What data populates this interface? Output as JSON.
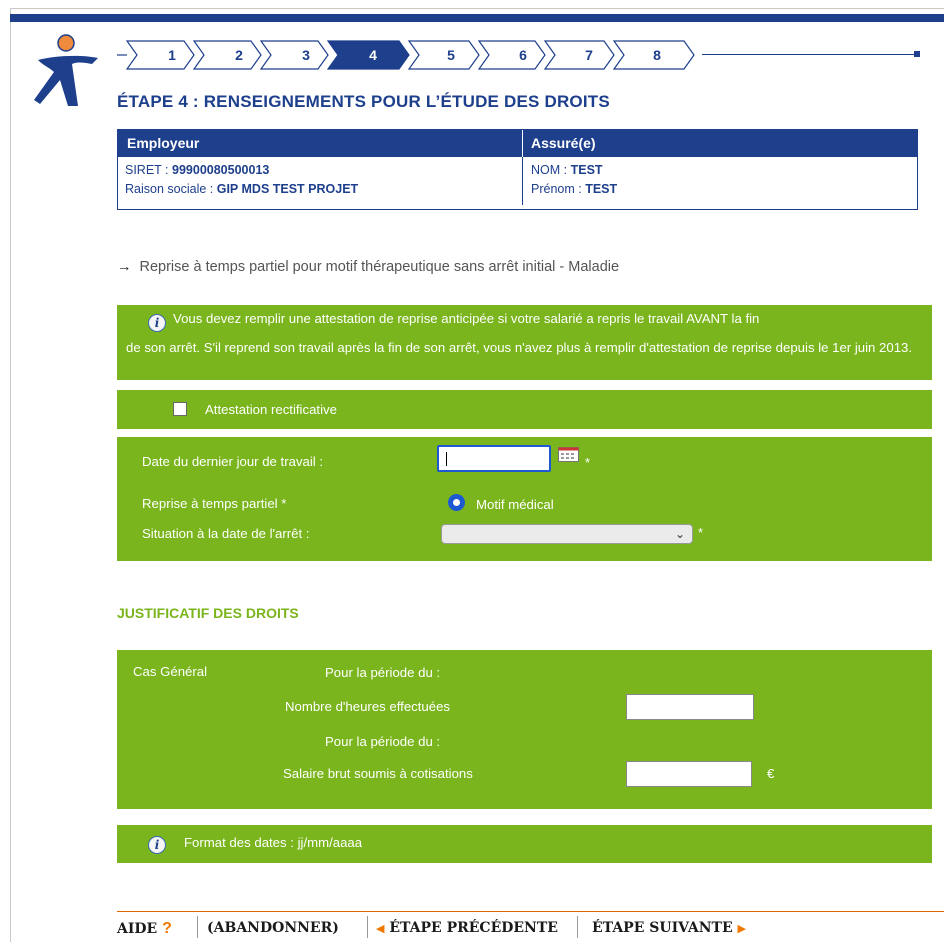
{
  "steps": [
    "1",
    "2",
    "3",
    "4",
    "5",
    "6",
    "7",
    "8"
  ],
  "active_step": "4",
  "page_title": "ÉTAPE 4 : RENSEIGNEMENTS POUR L’ÉTUDE DES DROITS",
  "employer": {
    "header": "Employeur",
    "siret_label": "SIRET : ",
    "siret_value": "99900080500013",
    "raison_label": "Raison sociale : ",
    "raison_value": "GIP MDS TEST PROJET"
  },
  "insured": {
    "header": "Assuré(e)",
    "nom_label": "NOM : ",
    "nom_value": "TEST",
    "prenom_label": "Prénom : ",
    "prenom_value": "TEST"
  },
  "subtitle": "Reprise à temps partiel pour motif thérapeutique sans arrêt initial - Maladie",
  "info_message_line1": "Vous devez remplir une attestation de reprise anticipée si votre salarié a repris le travail AVANT la fin",
  "info_message_rest": "de son arrêt. S'il reprend son travail après la fin de son arrêt, vous n'avez plus à remplir d'attestation de reprise depuis le 1er juin 2013.",
  "attestation_label": "Attestation rectificative",
  "form": {
    "last_day_label": "Date du dernier jour de travail :",
    "last_day_value": "",
    "required_mark": "*",
    "reprise_label": "Reprise à temps partiel  *",
    "motif_label": "Motif médical",
    "situation_label": "Situation à la date de l'arrêt :",
    "situation_value": ""
  },
  "justificatif_title": "JUSTIFICATIF DES DROITS",
  "justificatif": {
    "cas_general": "Cas Général",
    "periode_label_1": "Pour la période du :",
    "heures_label": "Nombre d'heures effectuées",
    "heures_value": "",
    "periode_label_2": "Pour la période du :",
    "salaire_label": "Salaire brut soumis à cotisations",
    "salaire_value": "",
    "currency": "€"
  },
  "date_format_note": "Format des dates : jj/mm/aaaa",
  "footer": {
    "aide": "AIDE",
    "aide_mark": "?",
    "abandonner": "(ABANDONNER)",
    "precedente": "ÉTAPE PRÉCÉDENTE",
    "suivante": "ÉTAPE SUIVANTE"
  },
  "colors": {
    "primary_blue": "#1d3f8c",
    "green": "#7ab51d",
    "orange": "#f07800"
  }
}
